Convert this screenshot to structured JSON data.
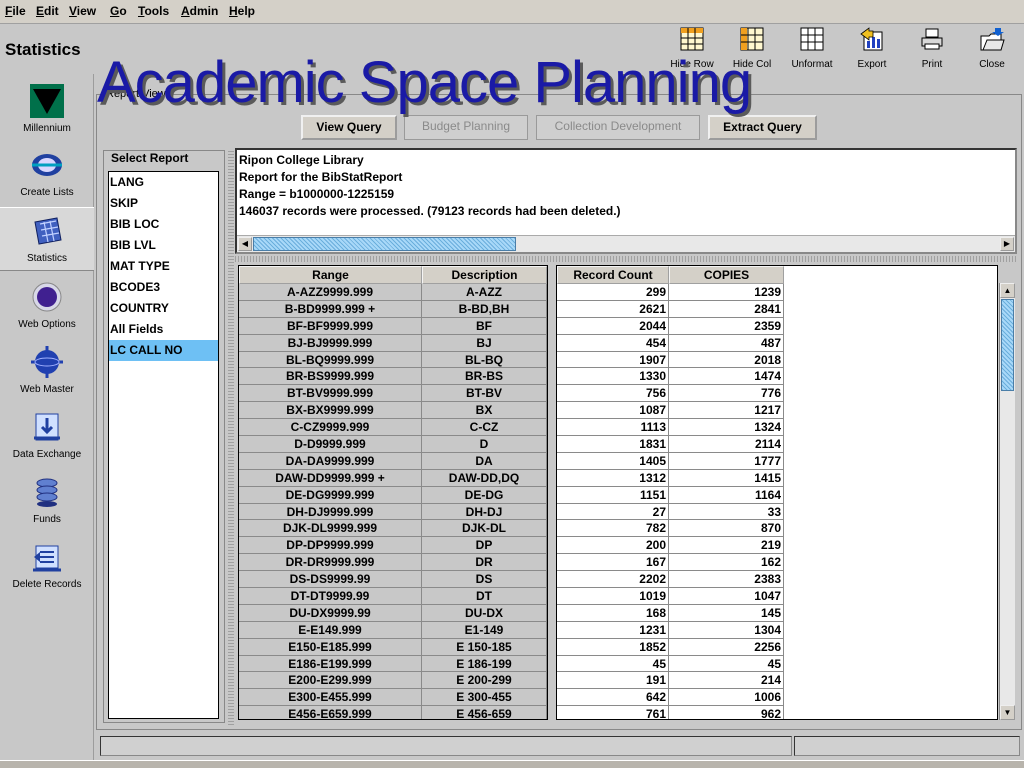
{
  "menu": [
    {
      "label": "File",
      "u": "F",
      "rest": "ile"
    },
    {
      "label": "Edit",
      "u": "E",
      "rest": "dit"
    },
    {
      "label": "View",
      "u": "V",
      "rest": "iew"
    },
    {
      "label": "Go",
      "u": "G",
      "rest": "o"
    },
    {
      "label": "Tools",
      "u": "T",
      "rest": "ools"
    },
    {
      "label": "Admin",
      "u": "A",
      "rest": "dmin"
    },
    {
      "label": "Help",
      "u": "H",
      "rest": "elp"
    }
  ],
  "header": {
    "title": "Statistics",
    "overlay_title": "Academic Space Planning"
  },
  "toolbar": [
    {
      "label": "Hide Row",
      "icon": "hide-row-icon"
    },
    {
      "label": "Hide Col",
      "icon": "hide-col-icon"
    },
    {
      "label": "Unformat",
      "icon": "unformat-icon"
    },
    {
      "label": "Export",
      "icon": "export-icon"
    },
    {
      "label": "Print",
      "icon": "print-icon"
    },
    {
      "label": "Close",
      "icon": "close-folder-icon"
    }
  ],
  "sidebar": [
    {
      "label": "Millennium",
      "icon": "millennium-logo-icon"
    },
    {
      "label": "Create Lists",
      "icon": "create-lists-icon"
    },
    {
      "label": "Statistics",
      "icon": "statistics-icon",
      "selected": true
    },
    {
      "label": "Web Options",
      "icon": "web-options-icon"
    },
    {
      "label": "Web Master",
      "icon": "web-master-icon"
    },
    {
      "label": "Data Exchange",
      "icon": "data-exchange-icon"
    },
    {
      "label": "Funds",
      "icon": "funds-icon"
    },
    {
      "label": "Delete Records",
      "icon": "delete-records-icon"
    }
  ],
  "report": {
    "legend": "Report View",
    "buttons": {
      "view_query": "View Query",
      "budget_planning": "Budget Planning",
      "collection_development": "Collection Development",
      "extract_query": "Extract Query"
    },
    "select_legend": "Select Report",
    "select_items": [
      "LANG",
      "SKIP",
      "BIB LOC",
      "BIB LVL",
      "MAT TYPE",
      "BCODE3",
      "COUNTRY",
      "All Fields",
      "LC CALL NO"
    ],
    "selected_item": "LC CALL NO",
    "info_lines": [
      "Ripon College Library",
      "Report for the BibStatReport",
      "Range = b1000000-1225159",
      "146037 records were processed.  (79123 records had been deleted.)"
    ]
  },
  "table": {
    "headers_left": [
      "Range",
      "Description"
    ],
    "headers_right": [
      "Record Count",
      "COPIES"
    ],
    "rows": [
      [
        "A-AZZ9999.999",
        "A-AZZ",
        "299",
        "1239"
      ],
      [
        "B-BD9999.999 +",
        "B-BD,BH",
        "2621",
        "2841"
      ],
      [
        "BF-BF9999.999",
        "BF",
        "2044",
        "2359"
      ],
      [
        "BJ-BJ9999.999",
        "BJ",
        "454",
        "487"
      ],
      [
        "BL-BQ9999.999",
        "BL-BQ",
        "1907",
        "2018"
      ],
      [
        "BR-BS9999.999",
        "BR-BS",
        "1330",
        "1474"
      ],
      [
        "BT-BV9999.999",
        "BT-BV",
        "756",
        "776"
      ],
      [
        "BX-BX9999.999",
        "BX",
        "1087",
        "1217"
      ],
      [
        "C-CZ9999.999",
        "C-CZ",
        "1113",
        "1324"
      ],
      [
        "D-D9999.999",
        "D",
        "1831",
        "2114"
      ],
      [
        "DA-DA9999.999",
        "DA",
        "1405",
        "1777"
      ],
      [
        "DAW-DD9999.999 +",
        "DAW-DD,DQ",
        "1312",
        "1415"
      ],
      [
        "DE-DG9999.999",
        "DE-DG",
        "1151",
        "1164"
      ],
      [
        "DH-DJ9999.999",
        "DH-DJ",
        "27",
        "33"
      ],
      [
        "DJK-DL9999.999",
        "DJK-DL",
        "782",
        "870"
      ],
      [
        "DP-DP9999.999",
        "DP",
        "200",
        "219"
      ],
      [
        "DR-DR9999.999",
        "DR",
        "167",
        "162"
      ],
      [
        "DS-DS9999.99",
        "DS",
        "2202",
        "2383"
      ],
      [
        "DT-DT9999.99",
        "DT",
        "1019",
        "1047"
      ],
      [
        "DU-DX9999.99",
        "DU-DX",
        "168",
        "145"
      ],
      [
        "E-E149.999",
        "E1-149",
        "1231",
        "1304"
      ],
      [
        "E150-E185.999",
        "E 150-185",
        "1852",
        "2256"
      ],
      [
        "E186-E199.999",
        "E 186-199",
        "45",
        "45"
      ],
      [
        "E200-E299.999",
        "E 200-299",
        "191",
        "214"
      ],
      [
        "E300-E455.999",
        "E 300-455",
        "642",
        "1006"
      ],
      [
        "E456-E659.999",
        "E 456-659",
        "761",
        "962"
      ]
    ]
  }
}
